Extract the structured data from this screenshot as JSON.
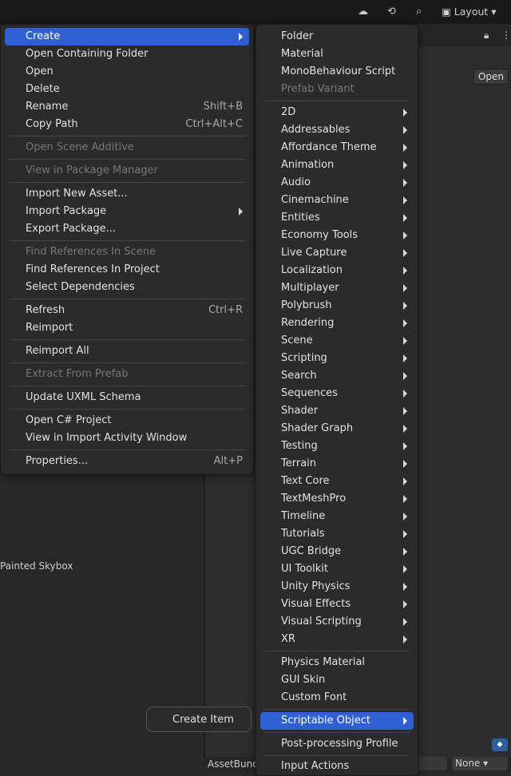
{
  "toolbar": {
    "layout_label": "Layout"
  },
  "background": {
    "open_button": "Open",
    "skybox_label": "Painted Skybox",
    "assetbundle_label": "AssetBund",
    "none_select": "None"
  },
  "context_menu": {
    "items": [
      {
        "label": "Create",
        "submenu": true,
        "highlighted": true
      },
      {
        "label": "Open Containing Folder"
      },
      {
        "label": "Open"
      },
      {
        "label": "Delete"
      },
      {
        "label": "Rename",
        "shortcut": "Shift+B"
      },
      {
        "label": "Copy Path",
        "shortcut": "Ctrl+Alt+C"
      },
      {
        "label": "Open Scene Additive",
        "disabled": true
      },
      {
        "label": "View in Package Manager",
        "disabled": true
      },
      {
        "label": "Import New Asset..."
      },
      {
        "label": "Import Package",
        "submenu": true
      },
      {
        "label": "Export Package..."
      },
      {
        "label": "Find References In Scene",
        "disabled": true
      },
      {
        "label": "Find References In Project"
      },
      {
        "label": "Select Dependencies"
      },
      {
        "label": "Refresh",
        "shortcut": "Ctrl+R"
      },
      {
        "label": "Reimport"
      },
      {
        "label": "Reimport All"
      },
      {
        "label": "Extract From Prefab",
        "disabled": true
      },
      {
        "label": "Update UXML Schema"
      },
      {
        "label": "Open C# Project"
      },
      {
        "label": "View in Import Activity Window"
      },
      {
        "label": "Properties...",
        "shortcut": "Alt+P"
      }
    ]
  },
  "create_submenu": {
    "items": [
      {
        "label": "Folder"
      },
      {
        "label": "Material"
      },
      {
        "label": "MonoBehaviour Script"
      },
      {
        "label": "Prefab Variant",
        "disabled": true
      },
      {
        "label": "2D",
        "submenu": true
      },
      {
        "label": "Addressables",
        "submenu": true
      },
      {
        "label": "Affordance Theme",
        "submenu": true
      },
      {
        "label": "Animation",
        "submenu": true
      },
      {
        "label": "Audio",
        "submenu": true
      },
      {
        "label": "Cinemachine",
        "submenu": true
      },
      {
        "label": "Entities",
        "submenu": true
      },
      {
        "label": "Economy Tools",
        "submenu": true
      },
      {
        "label": "Live Capture",
        "submenu": true
      },
      {
        "label": "Localization",
        "submenu": true
      },
      {
        "label": "Multiplayer",
        "submenu": true
      },
      {
        "label": "Polybrush",
        "submenu": true
      },
      {
        "label": "Rendering",
        "submenu": true
      },
      {
        "label": "Scene",
        "submenu": true
      },
      {
        "label": "Scripting",
        "submenu": true
      },
      {
        "label": "Search",
        "submenu": true
      },
      {
        "label": "Sequences",
        "submenu": true
      },
      {
        "label": "Shader",
        "submenu": true
      },
      {
        "label": "Shader Graph",
        "submenu": true
      },
      {
        "label": "Testing",
        "submenu": true
      },
      {
        "label": "Terrain",
        "submenu": true
      },
      {
        "label": "Text Core",
        "submenu": true
      },
      {
        "label": "TextMeshPro",
        "submenu": true
      },
      {
        "label": "Timeline",
        "submenu": true
      },
      {
        "label": "Tutorials",
        "submenu": true
      },
      {
        "label": "UGC Bridge",
        "submenu": true
      },
      {
        "label": "UI Toolkit",
        "submenu": true
      },
      {
        "label": "Unity Physics",
        "submenu": true
      },
      {
        "label": "Visual Effects",
        "submenu": true
      },
      {
        "label": "Visual Scripting",
        "submenu": true
      },
      {
        "label": "XR",
        "submenu": true
      },
      {
        "label": "Physics Material"
      },
      {
        "label": "GUI Skin"
      },
      {
        "label": "Custom Font"
      },
      {
        "label": "Scriptable Object",
        "submenu": true,
        "highlighted": true
      },
      {
        "label": "Post-processing Profile"
      },
      {
        "label": "Input Actions"
      }
    ]
  },
  "scriptable_submenu": {
    "items": [
      {
        "label": "Create Item"
      }
    ]
  },
  "colors": {
    "highlight": "#2f5fd1",
    "menu_bg": "#2b2b2b"
  }
}
